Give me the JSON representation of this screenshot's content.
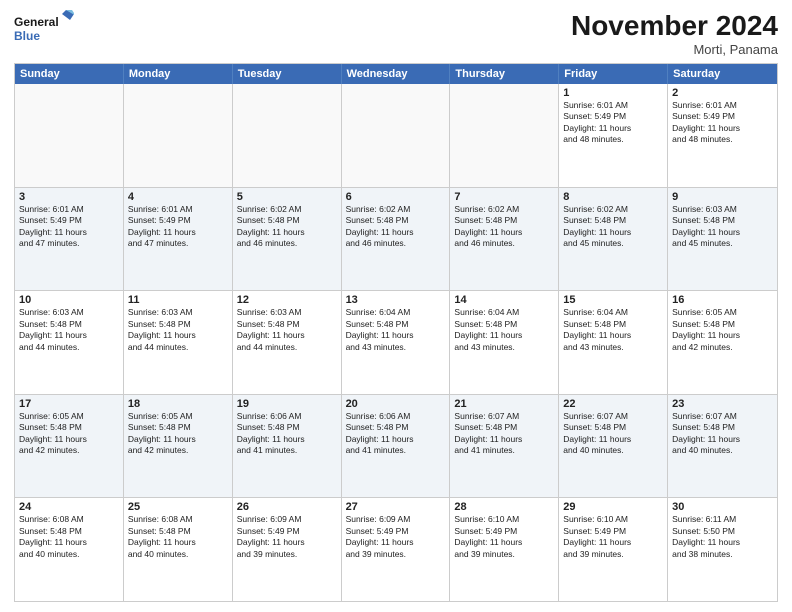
{
  "header": {
    "logo_line1": "General",
    "logo_line2": "Blue",
    "month_title": "November 2024",
    "location": "Morti, Panama"
  },
  "days_of_week": [
    "Sunday",
    "Monday",
    "Tuesday",
    "Wednesday",
    "Thursday",
    "Friday",
    "Saturday"
  ],
  "weeks": [
    [
      {
        "day": "",
        "info": ""
      },
      {
        "day": "",
        "info": ""
      },
      {
        "day": "",
        "info": ""
      },
      {
        "day": "",
        "info": ""
      },
      {
        "day": "",
        "info": ""
      },
      {
        "day": "1",
        "info": "Sunrise: 6:01 AM\nSunset: 5:49 PM\nDaylight: 11 hours\nand 48 minutes."
      },
      {
        "day": "2",
        "info": "Sunrise: 6:01 AM\nSunset: 5:49 PM\nDaylight: 11 hours\nand 48 minutes."
      }
    ],
    [
      {
        "day": "3",
        "info": "Sunrise: 6:01 AM\nSunset: 5:49 PM\nDaylight: 11 hours\nand 47 minutes."
      },
      {
        "day": "4",
        "info": "Sunrise: 6:01 AM\nSunset: 5:49 PM\nDaylight: 11 hours\nand 47 minutes."
      },
      {
        "day": "5",
        "info": "Sunrise: 6:02 AM\nSunset: 5:48 PM\nDaylight: 11 hours\nand 46 minutes."
      },
      {
        "day": "6",
        "info": "Sunrise: 6:02 AM\nSunset: 5:48 PM\nDaylight: 11 hours\nand 46 minutes."
      },
      {
        "day": "7",
        "info": "Sunrise: 6:02 AM\nSunset: 5:48 PM\nDaylight: 11 hours\nand 46 minutes."
      },
      {
        "day": "8",
        "info": "Sunrise: 6:02 AM\nSunset: 5:48 PM\nDaylight: 11 hours\nand 45 minutes."
      },
      {
        "day": "9",
        "info": "Sunrise: 6:03 AM\nSunset: 5:48 PM\nDaylight: 11 hours\nand 45 minutes."
      }
    ],
    [
      {
        "day": "10",
        "info": "Sunrise: 6:03 AM\nSunset: 5:48 PM\nDaylight: 11 hours\nand 44 minutes."
      },
      {
        "day": "11",
        "info": "Sunrise: 6:03 AM\nSunset: 5:48 PM\nDaylight: 11 hours\nand 44 minutes."
      },
      {
        "day": "12",
        "info": "Sunrise: 6:03 AM\nSunset: 5:48 PM\nDaylight: 11 hours\nand 44 minutes."
      },
      {
        "day": "13",
        "info": "Sunrise: 6:04 AM\nSunset: 5:48 PM\nDaylight: 11 hours\nand 43 minutes."
      },
      {
        "day": "14",
        "info": "Sunrise: 6:04 AM\nSunset: 5:48 PM\nDaylight: 11 hours\nand 43 minutes."
      },
      {
        "day": "15",
        "info": "Sunrise: 6:04 AM\nSunset: 5:48 PM\nDaylight: 11 hours\nand 43 minutes."
      },
      {
        "day": "16",
        "info": "Sunrise: 6:05 AM\nSunset: 5:48 PM\nDaylight: 11 hours\nand 42 minutes."
      }
    ],
    [
      {
        "day": "17",
        "info": "Sunrise: 6:05 AM\nSunset: 5:48 PM\nDaylight: 11 hours\nand 42 minutes."
      },
      {
        "day": "18",
        "info": "Sunrise: 6:05 AM\nSunset: 5:48 PM\nDaylight: 11 hours\nand 42 minutes."
      },
      {
        "day": "19",
        "info": "Sunrise: 6:06 AM\nSunset: 5:48 PM\nDaylight: 11 hours\nand 41 minutes."
      },
      {
        "day": "20",
        "info": "Sunrise: 6:06 AM\nSunset: 5:48 PM\nDaylight: 11 hours\nand 41 minutes."
      },
      {
        "day": "21",
        "info": "Sunrise: 6:07 AM\nSunset: 5:48 PM\nDaylight: 11 hours\nand 41 minutes."
      },
      {
        "day": "22",
        "info": "Sunrise: 6:07 AM\nSunset: 5:48 PM\nDaylight: 11 hours\nand 40 minutes."
      },
      {
        "day": "23",
        "info": "Sunrise: 6:07 AM\nSunset: 5:48 PM\nDaylight: 11 hours\nand 40 minutes."
      }
    ],
    [
      {
        "day": "24",
        "info": "Sunrise: 6:08 AM\nSunset: 5:48 PM\nDaylight: 11 hours\nand 40 minutes."
      },
      {
        "day": "25",
        "info": "Sunrise: 6:08 AM\nSunset: 5:48 PM\nDaylight: 11 hours\nand 40 minutes."
      },
      {
        "day": "26",
        "info": "Sunrise: 6:09 AM\nSunset: 5:49 PM\nDaylight: 11 hours\nand 39 minutes."
      },
      {
        "day": "27",
        "info": "Sunrise: 6:09 AM\nSunset: 5:49 PM\nDaylight: 11 hours\nand 39 minutes."
      },
      {
        "day": "28",
        "info": "Sunrise: 6:10 AM\nSunset: 5:49 PM\nDaylight: 11 hours\nand 39 minutes."
      },
      {
        "day": "29",
        "info": "Sunrise: 6:10 AM\nSunset: 5:49 PM\nDaylight: 11 hours\nand 39 minutes."
      },
      {
        "day": "30",
        "info": "Sunrise: 6:11 AM\nSunset: 5:50 PM\nDaylight: 11 hours\nand 38 minutes."
      }
    ]
  ]
}
